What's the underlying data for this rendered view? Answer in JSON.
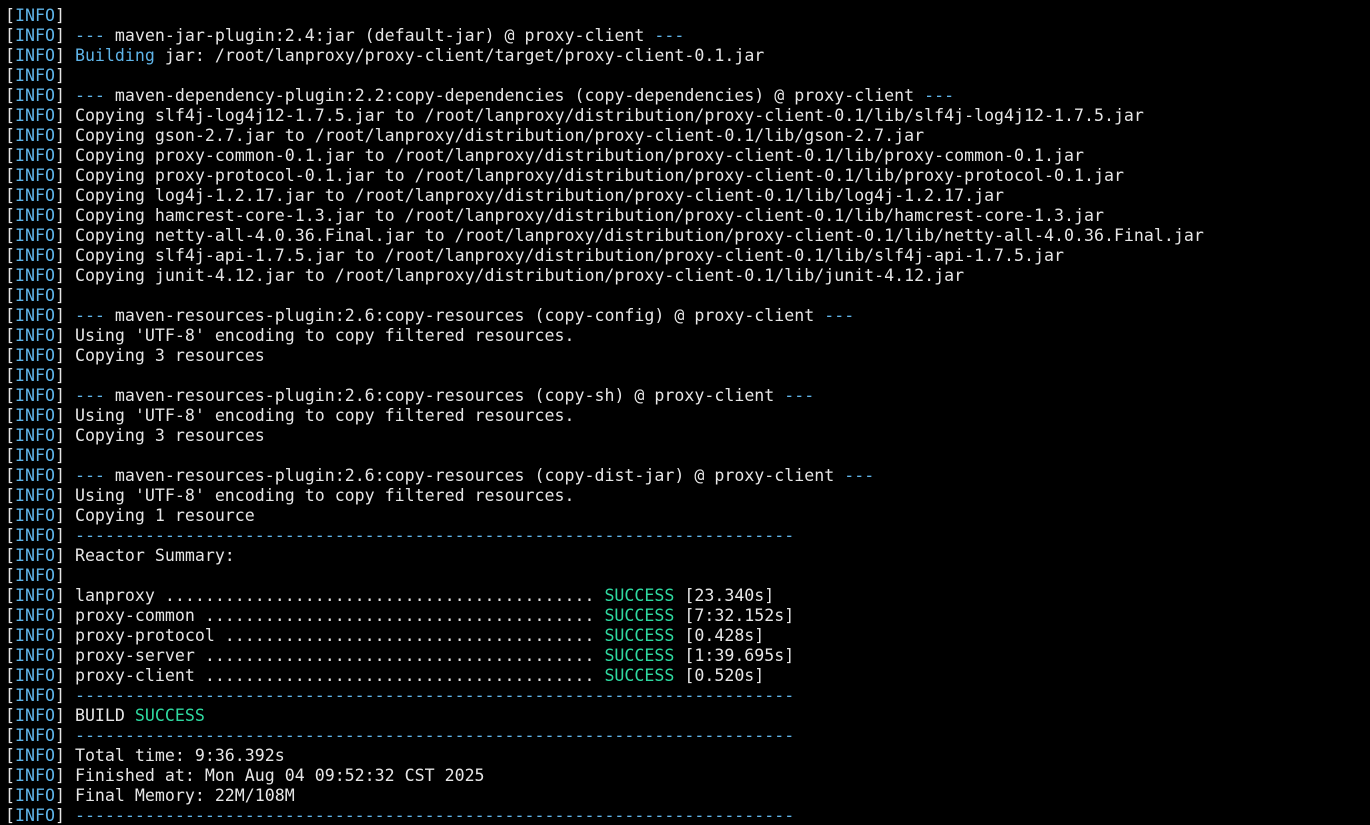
{
  "terminal": {
    "colors": {
      "background": "#000000",
      "default": "#e6e6e6",
      "info": "#5fb4e8",
      "success": "#2fd9a0"
    },
    "lines": [
      [
        [
          "[",
          "default"
        ],
        [
          "INFO",
          "info"
        ],
        [
          "]",
          "default"
        ]
      ],
      [
        [
          "[",
          "default"
        ],
        [
          "INFO",
          "info"
        ],
        [
          "] ",
          "default"
        ],
        [
          "---",
          "dashes"
        ],
        [
          " maven-jar-plugin:2.4:jar (default-jar) @ proxy-client ",
          "default"
        ],
        [
          "---",
          "dashes"
        ]
      ],
      [
        [
          "[",
          "default"
        ],
        [
          "INFO",
          "info"
        ],
        [
          "] ",
          "default"
        ],
        [
          "Building",
          "building"
        ],
        [
          " jar: /root/lanproxy/proxy-client/target/proxy-client-0.1.jar",
          "default"
        ]
      ],
      [
        [
          "[",
          "default"
        ],
        [
          "INFO",
          "info"
        ],
        [
          "]",
          "default"
        ]
      ],
      [
        [
          "[",
          "default"
        ],
        [
          "INFO",
          "info"
        ],
        [
          "] ",
          "default"
        ],
        [
          "---",
          "dashes"
        ],
        [
          " maven-dependency-plugin:2.2:copy-dependencies (copy-dependencies) @ proxy-client ",
          "default"
        ],
        [
          "---",
          "dashes"
        ]
      ],
      [
        [
          "[",
          "default"
        ],
        [
          "INFO",
          "info"
        ],
        [
          "] Copying slf4j-log4j12-1.7.5.jar to /root/lanproxy/distribution/proxy-client-0.1/lib/slf4j-log4j12-1.7.5.jar",
          "default"
        ]
      ],
      [
        [
          "[",
          "default"
        ],
        [
          "INFO",
          "info"
        ],
        [
          "] Copying gson-2.7.jar to /root/lanproxy/distribution/proxy-client-0.1/lib/gson-2.7.jar",
          "default"
        ]
      ],
      [
        [
          "[",
          "default"
        ],
        [
          "INFO",
          "info"
        ],
        [
          "] Copying proxy-common-0.1.jar to /root/lanproxy/distribution/proxy-client-0.1/lib/proxy-common-0.1.jar",
          "default"
        ]
      ],
      [
        [
          "[",
          "default"
        ],
        [
          "INFO",
          "info"
        ],
        [
          "] Copying proxy-protocol-0.1.jar to /root/lanproxy/distribution/proxy-client-0.1/lib/proxy-protocol-0.1.jar",
          "default"
        ]
      ],
      [
        [
          "[",
          "default"
        ],
        [
          "INFO",
          "info"
        ],
        [
          "] Copying log4j-1.2.17.jar to /root/lanproxy/distribution/proxy-client-0.1/lib/log4j-1.2.17.jar",
          "default"
        ]
      ],
      [
        [
          "[",
          "default"
        ],
        [
          "INFO",
          "info"
        ],
        [
          "] Copying hamcrest-core-1.3.jar to /root/lanproxy/distribution/proxy-client-0.1/lib/hamcrest-core-1.3.jar",
          "default"
        ]
      ],
      [
        [
          "[",
          "default"
        ],
        [
          "INFO",
          "info"
        ],
        [
          "] Copying netty-all-4.0.36.Final.jar to /root/lanproxy/distribution/proxy-client-0.1/lib/netty-all-4.0.36.Final.jar",
          "default"
        ]
      ],
      [
        [
          "[",
          "default"
        ],
        [
          "INFO",
          "info"
        ],
        [
          "] Copying slf4j-api-1.7.5.jar to /root/lanproxy/distribution/proxy-client-0.1/lib/slf4j-api-1.7.5.jar",
          "default"
        ]
      ],
      [
        [
          "[",
          "default"
        ],
        [
          "INFO",
          "info"
        ],
        [
          "] Copying junit-4.12.jar to /root/lanproxy/distribution/proxy-client-0.1/lib/junit-4.12.jar",
          "default"
        ]
      ],
      [
        [
          "[",
          "default"
        ],
        [
          "INFO",
          "info"
        ],
        [
          "]",
          "default"
        ]
      ],
      [
        [
          "[",
          "default"
        ],
        [
          "INFO",
          "info"
        ],
        [
          "] ",
          "default"
        ],
        [
          "---",
          "dashes"
        ],
        [
          " maven-resources-plugin:2.6:copy-resources (copy-config) @ proxy-client ",
          "default"
        ],
        [
          "---",
          "dashes"
        ]
      ],
      [
        [
          "[",
          "default"
        ],
        [
          "INFO",
          "info"
        ],
        [
          "] Using 'UTF-8' encoding to copy filtered resources.",
          "default"
        ]
      ],
      [
        [
          "[",
          "default"
        ],
        [
          "INFO",
          "info"
        ],
        [
          "] Copying 3 resources",
          "default"
        ]
      ],
      [
        [
          "[",
          "default"
        ],
        [
          "INFO",
          "info"
        ],
        [
          "]",
          "default"
        ]
      ],
      [
        [
          "[",
          "default"
        ],
        [
          "INFO",
          "info"
        ],
        [
          "] ",
          "default"
        ],
        [
          "---",
          "dashes"
        ],
        [
          " maven-resources-plugin:2.6:copy-resources (copy-sh) @ proxy-client ",
          "default"
        ],
        [
          "---",
          "dashes"
        ]
      ],
      [
        [
          "[",
          "default"
        ],
        [
          "INFO",
          "info"
        ],
        [
          "] Using 'UTF-8' encoding to copy filtered resources.",
          "default"
        ]
      ],
      [
        [
          "[",
          "default"
        ],
        [
          "INFO",
          "info"
        ],
        [
          "] Copying 3 resources",
          "default"
        ]
      ],
      [
        [
          "[",
          "default"
        ],
        [
          "INFO",
          "info"
        ],
        [
          "]",
          "default"
        ]
      ],
      [
        [
          "[",
          "default"
        ],
        [
          "INFO",
          "info"
        ],
        [
          "] ",
          "default"
        ],
        [
          "---",
          "dashes"
        ],
        [
          " maven-resources-plugin:2.6:copy-resources (copy-dist-jar) @ proxy-client ",
          "default"
        ],
        [
          "---",
          "dashes"
        ]
      ],
      [
        [
          "[",
          "default"
        ],
        [
          "INFO",
          "info"
        ],
        [
          "] Using 'UTF-8' encoding to copy filtered resources.",
          "default"
        ]
      ],
      [
        [
          "[",
          "default"
        ],
        [
          "INFO",
          "info"
        ],
        [
          "] Copying 1 resource",
          "default"
        ]
      ],
      [
        [
          "[",
          "default"
        ],
        [
          "INFO",
          "info"
        ],
        [
          "] ",
          "default"
        ],
        [
          "------------------------------------------------------------------------",
          "dashes"
        ]
      ],
      [
        [
          "[",
          "default"
        ],
        [
          "INFO",
          "info"
        ],
        [
          "] Reactor Summary:",
          "default"
        ]
      ],
      [
        [
          "[",
          "default"
        ],
        [
          "INFO",
          "info"
        ],
        [
          "]",
          "default"
        ]
      ],
      [
        [
          "[",
          "default"
        ],
        [
          "INFO",
          "info"
        ],
        [
          "] lanproxy ........................................... ",
          "default"
        ],
        [
          "SUCCESS",
          "success"
        ],
        [
          " [23.340s]",
          "default"
        ]
      ],
      [
        [
          "[",
          "default"
        ],
        [
          "INFO",
          "info"
        ],
        [
          "] proxy-common ....................................... ",
          "default"
        ],
        [
          "SUCCESS",
          "success"
        ],
        [
          " [7:32.152s]",
          "default"
        ]
      ],
      [
        [
          "[",
          "default"
        ],
        [
          "INFO",
          "info"
        ],
        [
          "] proxy-protocol ..................................... ",
          "default"
        ],
        [
          "SUCCESS",
          "success"
        ],
        [
          " [0.428s]",
          "default"
        ]
      ],
      [
        [
          "[",
          "default"
        ],
        [
          "INFO",
          "info"
        ],
        [
          "] proxy-server ....................................... ",
          "default"
        ],
        [
          "SUCCESS",
          "success"
        ],
        [
          " [1:39.695s]",
          "default"
        ]
      ],
      [
        [
          "[",
          "default"
        ],
        [
          "INFO",
          "info"
        ],
        [
          "] proxy-client ....................................... ",
          "default"
        ],
        [
          "SUCCESS",
          "success"
        ],
        [
          " [0.520s]",
          "default"
        ]
      ],
      [
        [
          "[",
          "default"
        ],
        [
          "INFO",
          "info"
        ],
        [
          "] ",
          "default"
        ],
        [
          "------------------------------------------------------------------------",
          "dashes"
        ]
      ],
      [
        [
          "[",
          "default"
        ],
        [
          "INFO",
          "info"
        ],
        [
          "] BUILD ",
          "default"
        ],
        [
          "SUCCESS",
          "success"
        ]
      ],
      [
        [
          "[",
          "default"
        ],
        [
          "INFO",
          "info"
        ],
        [
          "] ",
          "default"
        ],
        [
          "------------------------------------------------------------------------",
          "dashes"
        ]
      ],
      [
        [
          "[",
          "default"
        ],
        [
          "INFO",
          "info"
        ],
        [
          "] Total time: 9:36.392s",
          "default"
        ]
      ],
      [
        [
          "[",
          "default"
        ],
        [
          "INFO",
          "info"
        ],
        [
          "] Finished at: Mon Aug 04 09:52:32 CST 2025",
          "default"
        ]
      ],
      [
        [
          "[",
          "default"
        ],
        [
          "INFO",
          "info"
        ],
        [
          "] Final Memory: 22M/108M",
          "default"
        ]
      ],
      [
        [
          "[",
          "default"
        ],
        [
          "INFO",
          "info"
        ],
        [
          "] ",
          "default"
        ],
        [
          "------------------------------------------------------------------------",
          "dashes"
        ]
      ]
    ]
  }
}
